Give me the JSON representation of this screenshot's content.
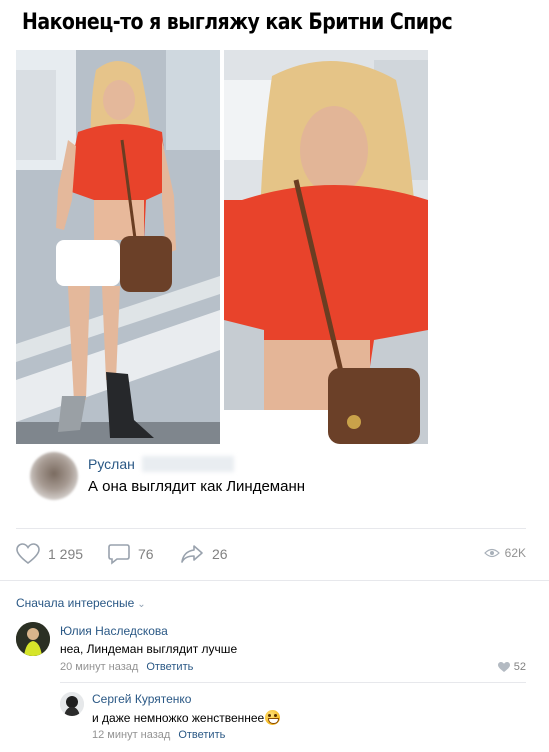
{
  "post": {
    "title": "Наконец-то я выгляжу как Бритни Спирс"
  },
  "quote": {
    "author": "Руслан",
    "text": "А она выглядит как Линдеманн"
  },
  "actions": {
    "likes": "1 295",
    "comments": "76",
    "shares": "26",
    "views": "62K"
  },
  "comments_section": {
    "sort_label": "Сначала интересные"
  },
  "comments": [
    {
      "author": "Юлия Наследскова",
      "text": "неа, Линдеман выглядит лучше",
      "time": "20 минут назад",
      "reply_label": "Ответить",
      "likes": "52"
    },
    {
      "author": "Сергей Курятенко",
      "text": "и даже немножко женственнее",
      "time": "12 минут назад",
      "reply_label": "Ответить"
    }
  ],
  "colors": {
    "link": "#2a5885",
    "meta": "#939393",
    "shirt": "#e8432b"
  }
}
